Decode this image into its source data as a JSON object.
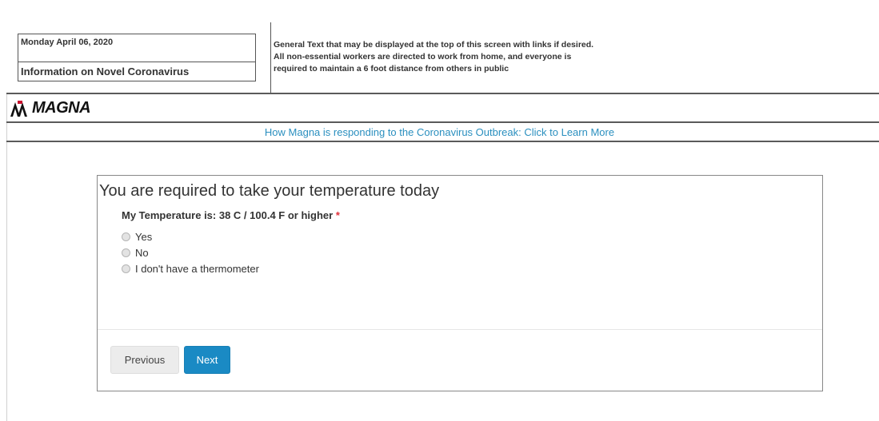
{
  "header": {
    "date": "Monday April 06, 2020",
    "info_title": "Information on Novel Coronavirus",
    "general_text_lines": [
      "General Text that may be displayed at the top of this screen with links if desired.",
      "All non-essential workers are directed to work from home, and everyone is",
      "required to maintain a 6 foot distance from others in public"
    ]
  },
  "brand": {
    "logo_text": "MAGNA",
    "logo_icon": "magna-logo-icon"
  },
  "banner": {
    "link_text": "How Magna is responding to the Coronavirus Outbreak: Click to Learn More",
    "link_color": "#2a8fbf"
  },
  "survey": {
    "title": "You are required to take your temperature today",
    "question": "My Temperature is: 38 C / 100.4 F or higher",
    "required_mark": "*",
    "options": [
      {
        "label": "Yes",
        "selected": false
      },
      {
        "label": "No",
        "selected": false
      },
      {
        "label": "I don't have a thermometer",
        "selected": false
      }
    ]
  },
  "buttons": {
    "previous": "Previous",
    "next": "Next",
    "next_color": "#1a8ac4"
  },
  "colors": {
    "required": "#e0303a"
  }
}
